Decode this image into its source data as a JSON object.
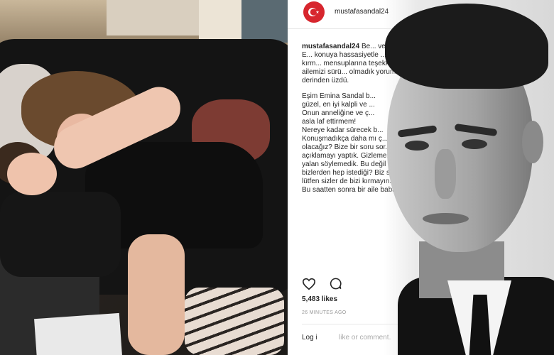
{
  "post": {
    "username": "mustafasandal24",
    "caption_user": "mustafasandal24",
    "caption_p1": "Be... ve çocuklarımız için E... konuya hassasiyetle ... etmiştim. Ricamı kırm... mensuplarına teşekk... Ne var ki, ailemizi sürü... olmadık yorumlar yap... bizi derinden üzdü.",
    "caption_p2": "Eşim Emina Sandal b...\ngüzel, en iyi kalpli ve ...\nOnun anneliğine ve ç...\nasla laf ettirmem!\nNereye kadar sürecek b...\nKonuşmadıkça daha mı ç...\nolacağız? Bize bir soru sor...\naçıklamayı yaptık. Gizleme...\nyalan söylemedik. Bu değil ...\nbizlerden hep istediği? Biz siz...\nlütfen sizler de bizi kırmayın.\nBu saatten sonra bir aile babası ol...",
    "likes": "5,483 likes",
    "time": "26 MINUTES AGO",
    "login": "Log i",
    "comment_placeholder": "like or comment."
  },
  "icons": {
    "avatar": "turkey-flag-icon",
    "like": "heart-icon",
    "comment": "comment-bubble-icon"
  },
  "colors": {
    "avatar_red": "#d7262e"
  }
}
